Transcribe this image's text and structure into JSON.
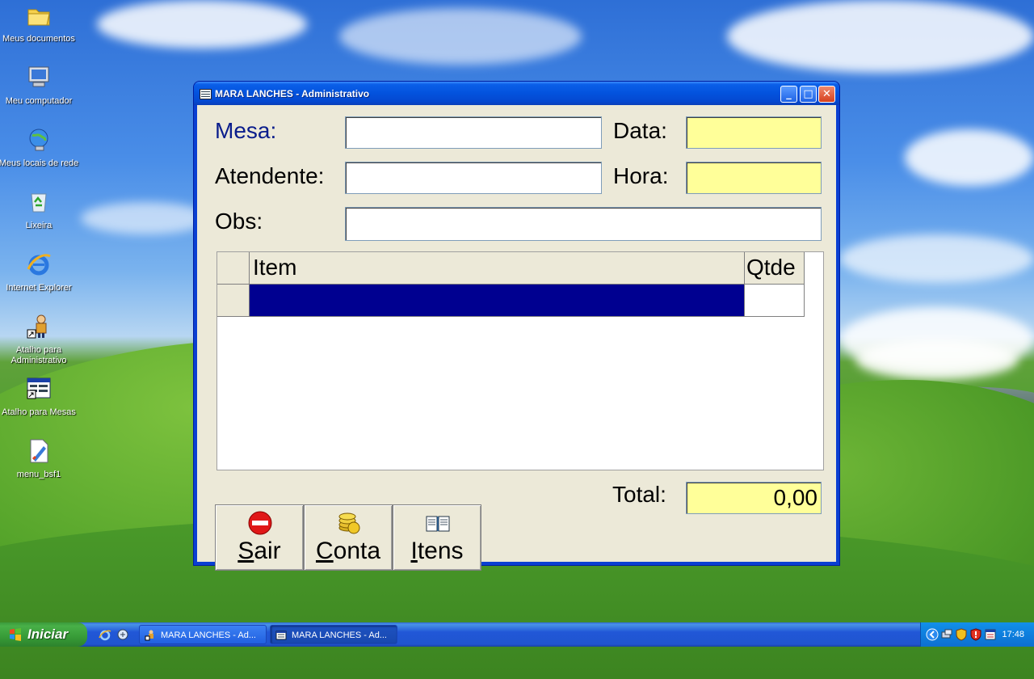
{
  "desktop": {
    "icons": [
      {
        "label": "Meus documentos"
      },
      {
        "label": "Meu computador"
      },
      {
        "label": "Meus locais de rede"
      },
      {
        "label": "Lixeira"
      },
      {
        "label": "Internet Explorer"
      },
      {
        "label": "Atalho para Administrativo"
      },
      {
        "label": "Atalho para Mesas"
      },
      {
        "label": "menu_bsf1"
      }
    ]
  },
  "window": {
    "title": "MARA LANCHES - Administrativo",
    "controls": {
      "minimize": "_",
      "maximize": "□",
      "close": "✕"
    }
  },
  "form": {
    "mesa_label": "Mesa:",
    "mesa_value": "",
    "data_label": "Data:",
    "data_value": "",
    "atendente_label": "Atendente:",
    "atendente_value": "",
    "hora_label": "Hora:",
    "hora_value": "",
    "obs_label": "Obs:",
    "obs_value": "",
    "total_label": "Total:",
    "total_value": "0,00"
  },
  "grid": {
    "columns": [
      "Item",
      "Qtde"
    ],
    "rows": [
      {
        "item": "",
        "qtde": ""
      }
    ]
  },
  "buttons": {
    "sair": {
      "prefix": "",
      "hotkey": "S",
      "rest": "air"
    },
    "conta": {
      "prefix": "",
      "hotkey": "C",
      "rest": "onta"
    },
    "itens": {
      "prefix": "",
      "hotkey": "I",
      "rest": "tens"
    }
  },
  "taskbar": {
    "start_label": "Iniciar",
    "tasks": [
      {
        "label": "MARA LANCHES - Ad..."
      },
      {
        "label": "MARA LANCHES - Ad..."
      }
    ],
    "clock": "17:48"
  },
  "colors": {
    "title_bar": "#0352dd",
    "window_bg": "#ece9d8",
    "readonly_field": "#ffff99",
    "selected_row": "#000090",
    "mesa_label": "#0a1d8c",
    "start_button": "#379b37"
  },
  "icons": {
    "sair": "no-entry-icon",
    "conta": "coins-icon",
    "itens": "book-icon"
  }
}
